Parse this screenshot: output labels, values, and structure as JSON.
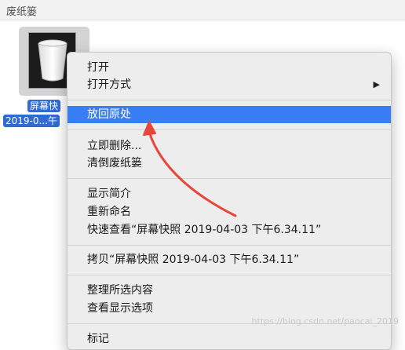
{
  "window": {
    "title": "废纸篓"
  },
  "file": {
    "name_line1": "屏幕快",
    "name_line2": "2019-0...午"
  },
  "menu": {
    "items": [
      {
        "label": "打开"
      },
      {
        "label": "打开方式",
        "submenu": true,
        "chevron": "▶"
      },
      {
        "label": "放回原处",
        "highlighted": true
      },
      {
        "label": "立即删除..."
      },
      {
        "label": "清倒废纸篓"
      },
      {
        "label": "显示简介"
      },
      {
        "label": "重新命名"
      },
      {
        "label": "快速查看“屏幕快照 2019-04-03 下午6.34.11”"
      },
      {
        "label": "拷贝“屏幕快照 2019-04-03 下午6.34.11”"
      },
      {
        "label": "整理所选内容"
      },
      {
        "label": "查看显示选项"
      },
      {
        "label": "标记"
      }
    ]
  },
  "watermark": "https://blog.csdn.net/paocai_2019",
  "colors": {
    "highlight": "#3a7ef5",
    "selection_label": "#2f6bd1",
    "annotation_arrow": "#e8453c"
  }
}
